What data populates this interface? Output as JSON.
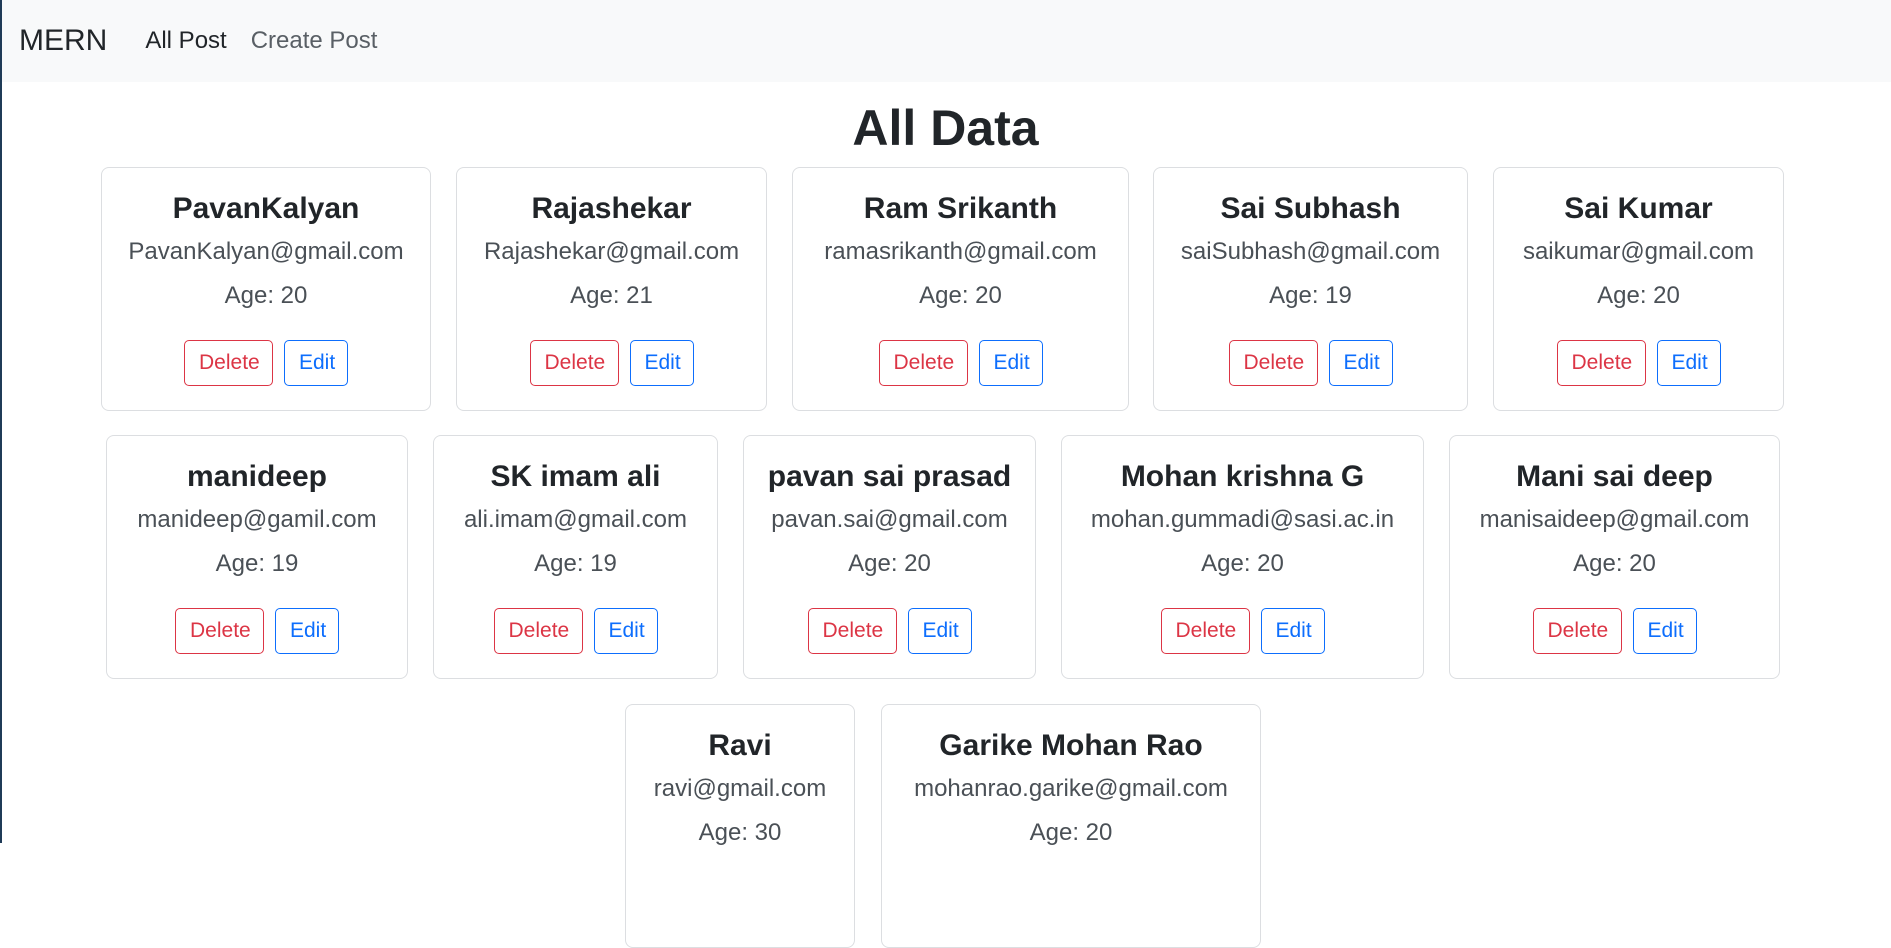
{
  "nav": {
    "brand": "MERN",
    "links": [
      "All Post",
      "Create Post"
    ]
  },
  "page": {
    "title": "All Data"
  },
  "labels": {
    "delete": "Delete",
    "edit": "Edit"
  },
  "cards": [
    {
      "name": "PavanKalyan",
      "email": "PavanKalyan@gmail.com",
      "age": "Age: 20"
    },
    {
      "name": "Rajashekar",
      "email": "Rajashekar@gmail.com",
      "age": "Age: 21"
    },
    {
      "name": "Ram Srikanth",
      "email": "ramasrikanth@gmail.com",
      "age": "Age: 20"
    },
    {
      "name": "Sai Subhash",
      "email": "saiSubhash@gmail.com",
      "age": "Age: 19"
    },
    {
      "name": "Sai Kumar",
      "email": "saikumar@gmail.com",
      "age": "Age: 20"
    },
    {
      "name": "manideep",
      "email": "manideep@gamil.com",
      "age": "Age: 19"
    },
    {
      "name": "SK imam ali",
      "email": "ali.imam@gmail.com",
      "age": "Age: 19"
    },
    {
      "name": "pavan sai prasad",
      "email": "pavan.sai@gmail.com",
      "age": "Age: 20"
    },
    {
      "name": "Mohan krishna G",
      "email": "mohan.gummadi@sasi.ac.in",
      "age": "Age: 20"
    },
    {
      "name": "Mani sai deep",
      "email": "manisaideep@gmail.com",
      "age": "Age: 20"
    },
    {
      "name": "Ravi",
      "email": "ravi@gmail.com",
      "age": "Age: 30"
    },
    {
      "name": "Garike Mohan Rao",
      "email": "mohanrao.garike@gmail.com",
      "age": "Age: 20"
    }
  ]
}
